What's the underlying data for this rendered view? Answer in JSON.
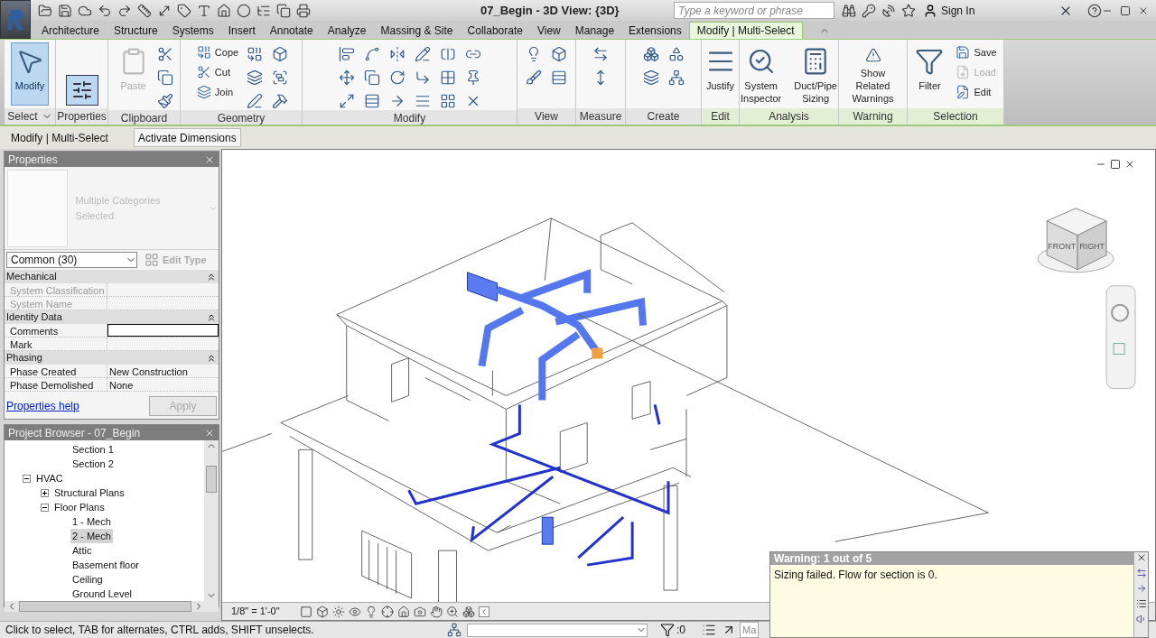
{
  "title_bar": {
    "title": "07_Begin - 3D View: {3D}",
    "search": {
      "placeholder": "Type a keyword or phrase"
    },
    "sign_in": "Sign In"
  },
  "tabs": [
    {
      "label": "Architecture",
      "selected": false
    },
    {
      "label": "Structure",
      "selected": false
    },
    {
      "label": "Systems",
      "selected": false
    },
    {
      "label": "Insert",
      "selected": false
    },
    {
      "label": "Annotate",
      "selected": false
    },
    {
      "label": "Analyze",
      "selected": false
    },
    {
      "label": "Massing & Site",
      "selected": false
    },
    {
      "label": "Collaborate",
      "selected": false
    },
    {
      "label": "View",
      "selected": false
    },
    {
      "label": "Manage",
      "selected": false
    },
    {
      "label": "Extensions",
      "selected": false
    },
    {
      "label": "Modify | Multi-Select",
      "selected": true
    }
  ],
  "ribbon": [
    {
      "label": "Select",
      "dropdown": true,
      "contextual": false,
      "tools": [
        {
          "kind": "large",
          "label": "Modify",
          "selected": true,
          "disabled": false
        }
      ]
    },
    {
      "label": "Properties",
      "contextual": false,
      "tools": [
        {
          "kind": "icon",
          "selected": true
        }
      ]
    },
    {
      "label": "Clipboard",
      "contextual": false,
      "tools": [
        {
          "kind": "large",
          "label": "Paste",
          "disabled": true
        }
      ]
    },
    {
      "label": "Geometry",
      "contextual": false,
      "tools": [
        {
          "kind": "small",
          "label": "Cope",
          "disabled": false
        },
        {
          "kind": "small",
          "label": "Cut",
          "disabled": false
        },
        {
          "kind": "small",
          "label": "Join",
          "disabled": false
        }
      ]
    },
    {
      "label": "Modify",
      "contextual": false
    },
    {
      "label": "View",
      "contextual": false
    },
    {
      "label": "Measure",
      "contextual": false
    },
    {
      "label": "Create",
      "contextual": false
    },
    {
      "label": "Edit",
      "contextual": true,
      "tools": [
        {
          "kind": "large",
          "label": "Justify",
          "disabled": false
        }
      ]
    },
    {
      "label": "Analysis",
      "contextual": true,
      "tools": [
        {
          "kind": "large",
          "label": "System Inspector",
          "disabled": false
        },
        {
          "kind": "large",
          "label": "Duct/Pipe Sizing",
          "disabled": false
        }
      ]
    },
    {
      "label": "Warning",
      "contextual": true,
      "tools": [
        {
          "kind": "large",
          "label": "Show Related Warnings",
          "disabled": false
        }
      ]
    },
    {
      "label": "Selection",
      "contextual": true,
      "tools": [
        {
          "kind": "large",
          "label": "Filter",
          "disabled": false
        },
        {
          "kind": "small",
          "label": "Save",
          "disabled": false
        },
        {
          "kind": "small",
          "label": "Load",
          "disabled": true
        },
        {
          "kind": "small",
          "label": "Edit",
          "disabled": false
        }
      ]
    }
  ],
  "options_bar": {
    "context": "Modify | Multi-Select",
    "buttons": [
      "Activate Dimensions"
    ]
  },
  "properties": {
    "title": "Properties",
    "type_name": "Multiple Categories Selected",
    "type_disabled": true,
    "filter": "Common (30)",
    "edit_type": {
      "label": "Edit Type",
      "disabled": true
    },
    "groups": [
      {
        "name": "Mechanical",
        "expanded": true,
        "rows": [
          {
            "label": "System Classification",
            "disabled": true,
            "editing": false
          },
          {
            "label": "System Name",
            "disabled": true,
            "editing": false
          }
        ]
      },
      {
        "name": "Identity Data",
        "expanded": true,
        "rows": [
          {
            "label": "Comments",
            "disabled": false,
            "editing": true
          },
          {
            "label": "Mark",
            "disabled": false,
            "editing": false
          }
        ]
      },
      {
        "name": "Phasing",
        "expanded": true,
        "rows": [
          {
            "label": "Phase Created",
            "value": "New Construction",
            "disabled": false,
            "editing": false
          },
          {
            "label": "Phase Demolished",
            "value": "None",
            "disabled": false,
            "editing": false
          }
        ]
      }
    ],
    "help_link": "Properties help",
    "apply": {
      "label": "Apply",
      "disabled": true
    }
  },
  "project_browser": {
    "title": "Project Browser - 07_Begin",
    "tree": [
      {
        "children": [
          {
            "children": [
              {
                "children": [
                  {
                    "label": "Section 1",
                    "selected": false
                  },
                  {
                    "label": "Section 2",
                    "selected": false
                  }
                ]
              }
            ]
          },
          {
            "label": "HVAC",
            "expanded": true,
            "selected": false,
            "children": [
              {
                "label": "Structural Plans",
                "expanded": false,
                "selected": false
              },
              {
                "label": "Floor Plans",
                "expanded": true,
                "selected": false,
                "children": [
                  {
                    "label": "1 - Mech",
                    "selected": false
                  },
                  {
                    "label": "2 - Mech",
                    "selected": true
                  },
                  {
                    "label": "Attic",
                    "selected": false
                  },
                  {
                    "label": "Basement floor",
                    "selected": false
                  },
                  {
                    "label": "Ceiling",
                    "selected": false
                  },
                  {
                    "label": "Ground Level",
                    "selected": false
                  }
                ]
              }
            ]
          }
        ]
      }
    ]
  },
  "view": {
    "view_cube": {
      "faces": [
        "FRONT",
        "RIGHT"
      ]
    },
    "scale": "1/8\" = 1'-0\""
  },
  "warning": {
    "title": "Warning: 1 out of 5",
    "message": "Sizing failed. Flow for section is 0."
  },
  "status_bar": {
    "hint": "Click to select, TAB for alternates, CTRL adds, SHIFT unselects.",
    "selection_count": ":0",
    "model": "Ma"
  }
}
